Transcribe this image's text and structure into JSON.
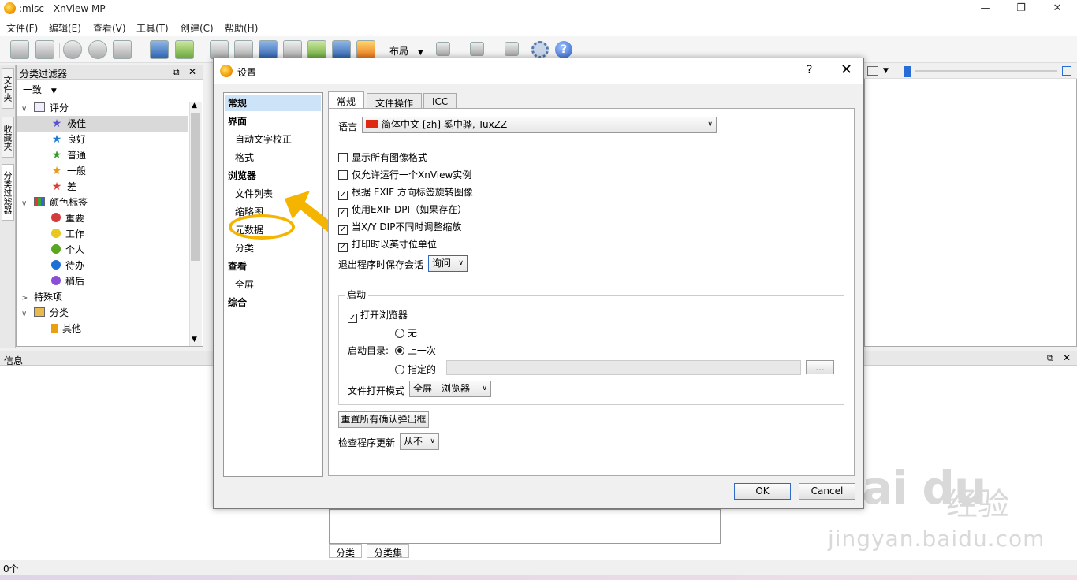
{
  "app": {
    "title": ":misc - XnView MP",
    "window_controls": [
      "—",
      "❐",
      "✕"
    ]
  },
  "menubar": [
    "文件(F)",
    "编辑(E)",
    "查看(V)",
    "工具(T)",
    "创建(C)",
    "帮助(H)"
  ],
  "toolbar": {
    "layout_label": "布局",
    "help_symbol": "?"
  },
  "side_tabs": [
    "文件夹",
    "收藏夹",
    "分类过滤器"
  ],
  "category_filter": {
    "title": "分类过滤器",
    "pin_icon": "⧉",
    "close_icon": "✕",
    "combo": "一致",
    "tree": [
      {
        "label": "评分",
        "expander": "∨",
        "indent": 0,
        "icon": "rating-icon"
      },
      {
        "label": "极佳",
        "indent": 1,
        "icon": "star-icon",
        "color": "#5a4fd6",
        "selected": true
      },
      {
        "label": "良好",
        "indent": 1,
        "icon": "star-icon",
        "color": "#1f7ad6"
      },
      {
        "label": "普通",
        "indent": 1,
        "icon": "star-icon",
        "color": "#3a9a2c"
      },
      {
        "label": "一般",
        "indent": 1,
        "icon": "star-icon",
        "color": "#e89a18"
      },
      {
        "label": "差",
        "indent": 1,
        "icon": "star-icon",
        "color": "#d6403b"
      },
      {
        "label": "颜色标签",
        "expander": "∨",
        "indent": 0,
        "icon": "color-label-icon"
      },
      {
        "label": "重要",
        "indent": 1,
        "icon": "dot-icon",
        "color": "#d63b3b"
      },
      {
        "label": "工作",
        "indent": 1,
        "icon": "dot-icon",
        "color": "#e8c81e"
      },
      {
        "label": "个人",
        "indent": 1,
        "icon": "dot-icon",
        "color": "#5aa61f"
      },
      {
        "label": "待办",
        "indent": 1,
        "icon": "dot-icon",
        "color": "#1f6fd6"
      },
      {
        "label": "稍后",
        "indent": 1,
        "icon": "dot-icon",
        "color": "#8a4fd6"
      },
      {
        "label": "特殊项",
        "expander": ">",
        "indent": 0,
        "icon": ""
      },
      {
        "label": "分类",
        "expander": "∨",
        "indent": 0,
        "icon": "category-icon"
      },
      {
        "label": "其他",
        "indent": 1,
        "icon": "bookmark-icon",
        "color": "#e8a010"
      }
    ]
  },
  "info_panel": {
    "title": "信息",
    "status_count": "0个"
  },
  "bottom_tabs": [
    "分类",
    "分类集"
  ],
  "watermark": {
    "logo": "Bai du",
    "chinese": "经验",
    "url": "jingyan.baidu.com"
  },
  "dialog": {
    "title": "设置",
    "help": "?",
    "close": "✕",
    "nav": [
      {
        "label": "常规",
        "bold": true
      },
      {
        "label": "界面",
        "bold": true
      },
      {
        "label": "自动文字校正",
        "bold": false
      },
      {
        "label": "格式",
        "bold": false
      },
      {
        "label": "浏览器",
        "bold": true
      },
      {
        "label": "文件列表",
        "bold": false
      },
      {
        "label": "缩略图",
        "bold": false
      },
      {
        "label": "元数据",
        "bold": false
      },
      {
        "label": "分类",
        "bold": false
      },
      {
        "label": "查看",
        "bold": true
      },
      {
        "label": "全屏",
        "bold": false
      },
      {
        "label": "综合",
        "bold": true
      }
    ],
    "tabs": [
      "常规",
      "文件操作",
      "ICC"
    ],
    "language_label": "语言",
    "language_value": "简体中文 [zh] 奚中骅, TuxZZ",
    "checkboxes": [
      {
        "label": "显示所有图像格式",
        "checked": false
      },
      {
        "label": "仅允许运行一个XnView实例",
        "checked": false
      },
      {
        "label": "根据 EXIF 方向标签旋转图像",
        "checked": true
      },
      {
        "label": "使用EXIF DPI（如果存在）",
        "checked": true
      },
      {
        "label": "当X/Y DIP不同时调整缩放",
        "checked": true
      },
      {
        "label": "打印时以英寸位单位",
        "checked": true
      }
    ],
    "save_session_label": "退出程序时保存会话",
    "save_session_value": "询问",
    "startup": {
      "group_title": "启动",
      "open_browser_label": "打开浏览器",
      "open_browser_checked": true,
      "dir_label": "启动目录:",
      "options": [
        {
          "label": "无",
          "selected": false
        },
        {
          "label": "上一次",
          "selected": true
        },
        {
          "label": "指定的",
          "selected": false
        }
      ],
      "browse_button": "...",
      "file_open_mode_label": "文件打开模式",
      "file_open_mode_value": "全屏 - 浏览器"
    },
    "reset_button": "重置所有确认弹出框",
    "check_updates_label": "检查程序更新",
    "check_updates_value": "从不",
    "ok": "OK",
    "cancel": "Cancel"
  }
}
